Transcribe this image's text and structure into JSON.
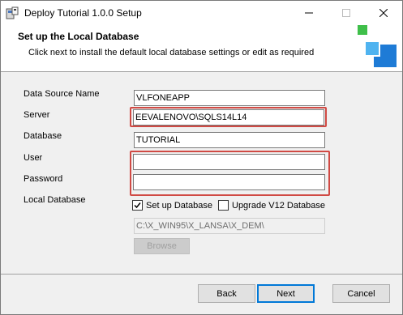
{
  "window": {
    "title": "Deploy Tutorial 1.0.0 Setup",
    "icon": "installer-icon"
  },
  "header": {
    "title": "Set up the Local Database",
    "subtitle": "Click next to install the default local database settings or edit as required"
  },
  "form": {
    "data_source_label": "Data Source Name",
    "data_source_value": "VLFONEAPP",
    "server_label": "Server",
    "server_value": "EEVALENOVO\\SQLS14L14",
    "database_label": "Database",
    "database_value": "TUTORIAL",
    "user_label": "User",
    "user_value": "",
    "password_label": "Password",
    "password_value": "",
    "local_db_label": "Local Database",
    "setup_db_label": "Set up Database",
    "setup_db_checked": true,
    "upgrade_label": "Upgrade V12 Database",
    "upgrade_checked": false,
    "path_value": "C:\\X_WIN95\\X_LANSA\\X_DEM\\",
    "browse_label": "Browse"
  },
  "buttons": {
    "back": "Back",
    "next": "Next",
    "cancel": "Cancel"
  },
  "colors": {
    "highlight_border": "#d04a44",
    "logo_green": "#3fbf4a",
    "logo_blue": "#1e7bd6",
    "logo_light_blue": "#4fb3f0"
  }
}
